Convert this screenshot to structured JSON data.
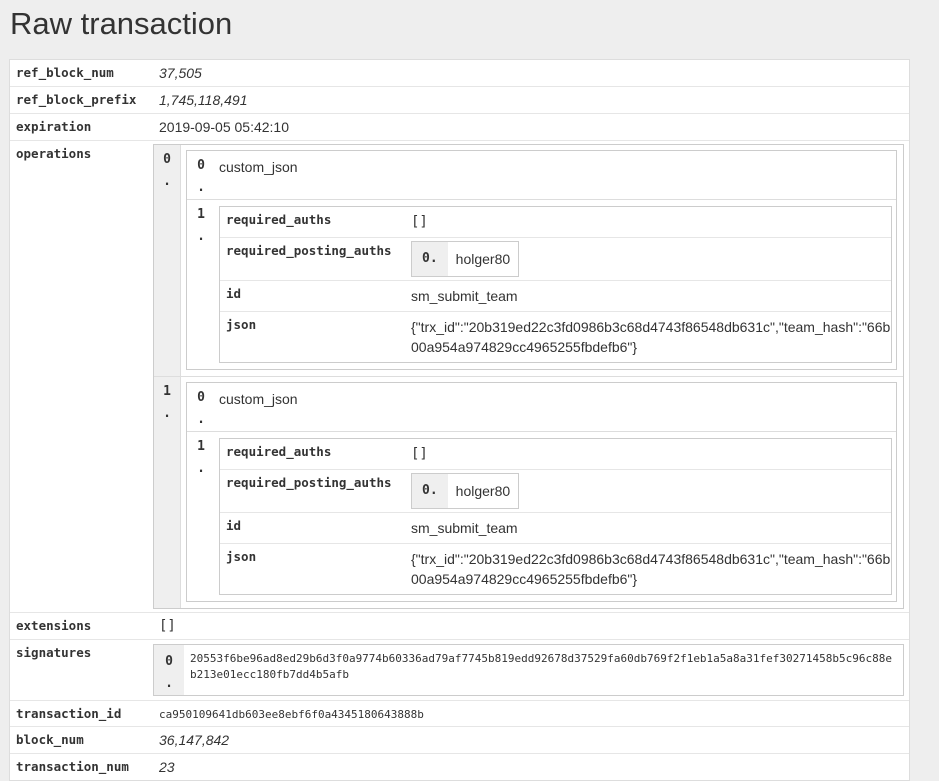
{
  "title": "Raw transaction",
  "fields": {
    "ref_block_num": {
      "key": "ref_block_num",
      "value": "37,505"
    },
    "ref_block_prefix": {
      "key": "ref_block_prefix",
      "value": "1,745,118,491"
    },
    "expiration": {
      "key": "expiration",
      "value": "2019-09-05 05:42:10"
    },
    "operations": {
      "key": "operations"
    },
    "extensions": {
      "key": "extensions",
      "value": "[]"
    },
    "signatures": {
      "key": "signatures"
    },
    "transaction_id": {
      "key": "transaction_id",
      "value": "ca950109641db603ee8ebf6f0a4345180643888b"
    },
    "block_num": {
      "key": "block_num",
      "value": "36,147,842"
    },
    "transaction_num": {
      "key": "transaction_num",
      "value": "23"
    }
  },
  "operations": [
    {
      "index": "0\n.",
      "type_index": "0\n.",
      "type": "custom_json",
      "data_index": "1\n.",
      "required_auths_key": "required_auths",
      "required_auths_value": "[]",
      "required_posting_auths_key": "required_posting_auths",
      "posting_index": "0.",
      "posting_value": "holger80",
      "id_key": "id",
      "id_value": "sm_submit_team",
      "json_key": "json",
      "json_value": "{\"trx_id\":\"20b319ed22c3fd0986b3c68d4743f86548db631c\",\"team_hash\":\"66b00a954a974829cc4965255fbdefb6\"}"
    },
    {
      "index": "1\n.",
      "type_index": "0\n.",
      "type": "custom_json",
      "data_index": "1\n.",
      "required_auths_key": "required_auths",
      "required_auths_value": "[]",
      "required_posting_auths_key": "required_posting_auths",
      "posting_index": "0.",
      "posting_value": "holger80",
      "id_key": "id",
      "id_value": "sm_submit_team",
      "json_key": "json",
      "json_value": "{\"trx_id\":\"20b319ed22c3fd0986b3c68d4743f86548db631c\",\"team_hash\":\"66b00a954a974829cc4965255fbdefb6\"}"
    }
  ],
  "signatures": [
    {
      "index": "0\n.",
      "value": "20553f6be96ad8ed29b6d3f0a9774b60336ad79af7745b819edd92678d37529fa60db769f2f1eb1a5a8a31fef30271458b5c96c88eb213e01ecc180fb7dd4b5afb"
    }
  ]
}
